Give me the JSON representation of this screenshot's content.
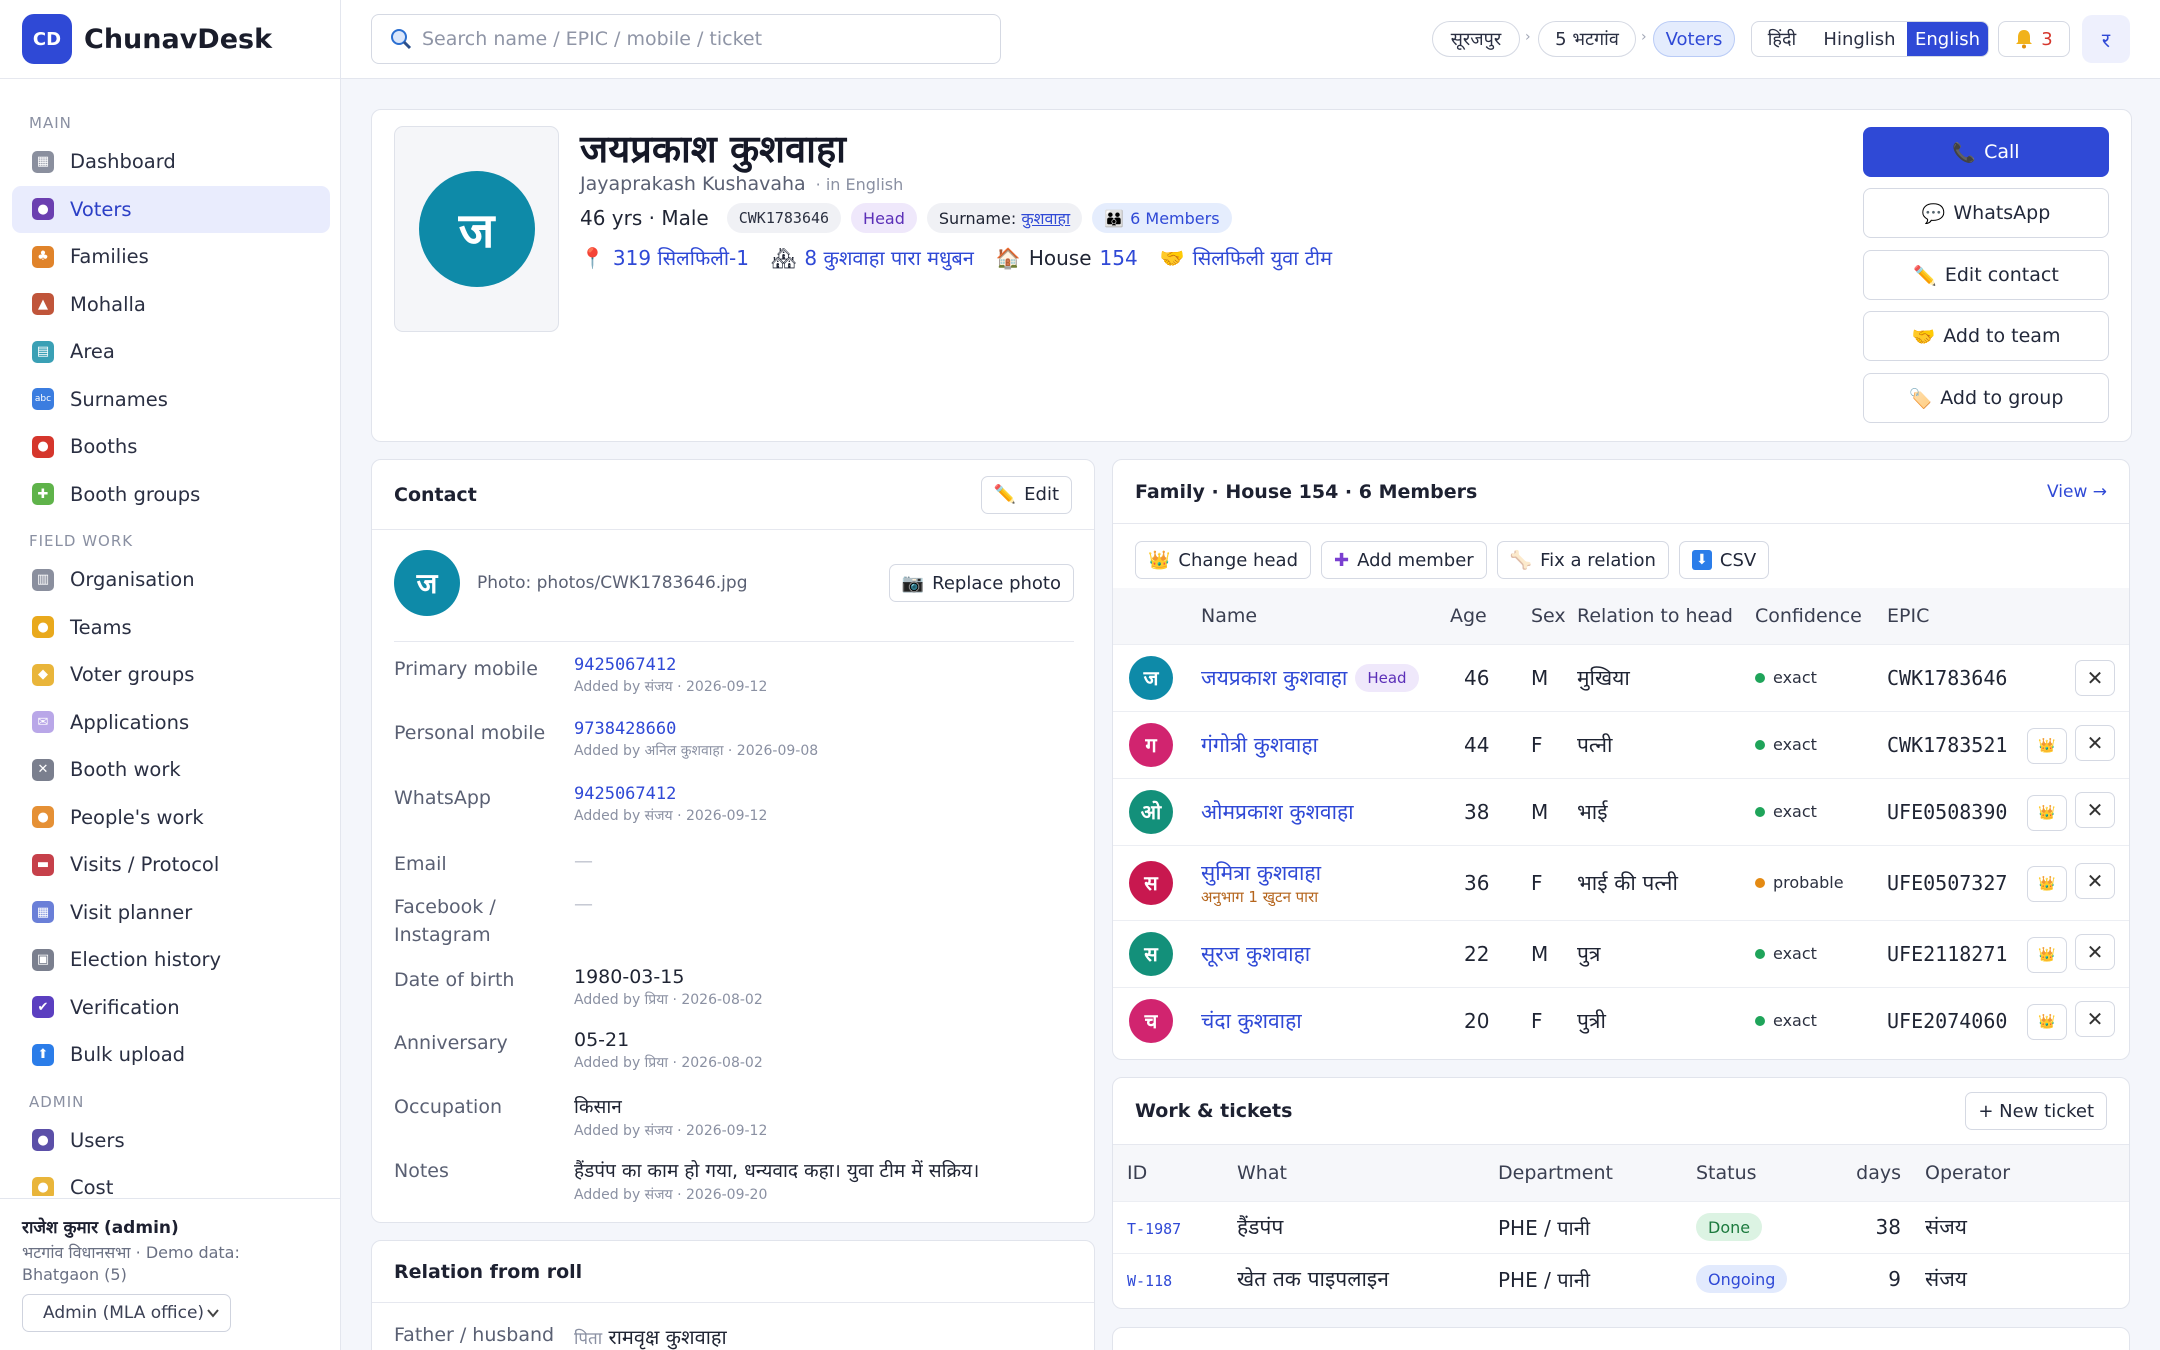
{
  "app": {
    "logo": "CD",
    "name": "ChunavDesk"
  },
  "sidebar": {
    "sections": [
      {
        "title": "MAIN",
        "items": [
          {
            "label": "Dashboard",
            "icon": "grid-icon"
          },
          {
            "label": "Voters",
            "icon": "person-icon",
            "active": true
          },
          {
            "label": "Families",
            "icon": "family-icon"
          },
          {
            "label": "Mohalla",
            "icon": "houses-icon"
          },
          {
            "label": "Area",
            "icon": "map-icon"
          },
          {
            "label": "Surnames",
            "icon": "abc-icon"
          },
          {
            "label": "Booths",
            "icon": "pin-icon"
          },
          {
            "label": "Booth groups",
            "icon": "puzzle-icon"
          }
        ]
      },
      {
        "title": "FIELD WORK",
        "items": [
          {
            "label": "Organisation",
            "icon": "building-icon"
          },
          {
            "label": "Teams",
            "icon": "handshake-icon"
          },
          {
            "label": "Voter groups",
            "icon": "tag-icon"
          },
          {
            "label": "Applications",
            "icon": "envelope-icon"
          },
          {
            "label": "Booth work",
            "icon": "tools-icon"
          },
          {
            "label": "People's work",
            "icon": "hand-icon"
          },
          {
            "label": "Visits / Protocol",
            "icon": "car-icon"
          },
          {
            "label": "Visit planner",
            "icon": "calendar-icon"
          },
          {
            "label": "Election history",
            "icon": "ballot-icon"
          },
          {
            "label": "Verification",
            "icon": "check-icon"
          },
          {
            "label": "Bulk upload",
            "icon": "upload-icon"
          }
        ]
      },
      {
        "title": "ADMIN",
        "items": [
          {
            "label": "Users",
            "icon": "users-icon"
          },
          {
            "label": "Cost",
            "icon": "coin-icon"
          }
        ]
      }
    ],
    "footer": {
      "user": "राजेश कुमार (admin)",
      "sub": "भटगांव विधानसभा · Demo data: Bhatgaon (5)",
      "role": "Admin (MLA office)"
    }
  },
  "topbar": {
    "search_placeholder": "Search name / EPIC / mobile / ticket",
    "crumbs": [
      "सूरजपुर",
      "5 भटगांव",
      "Voters"
    ],
    "languages": [
      "हिंदी",
      "Hinglish",
      "English"
    ],
    "active_language": "English",
    "notifications": "3",
    "user_initial": "र"
  },
  "profile": {
    "initial": "ज",
    "name": "जयप्रकाश कुशवाहा",
    "name_en": "Jayaprakash Kushavaha",
    "name_en_note": "· in English",
    "age_sex": "46 yrs · Male",
    "epic": "CWK1783646",
    "role_tag": "Head",
    "surname_label": "Surname:",
    "surname": "कुशवाहा",
    "members": "6 Members",
    "booth": "319 सिलफिली-1",
    "mohalla": "8 कुशवाहा पारा मधुबन",
    "house_label": "House",
    "house": "154",
    "team": "सिलफिली युवा टीम",
    "actions": [
      "Call",
      "WhatsApp",
      "Edit contact",
      "Add to team",
      "Add to group"
    ]
  },
  "contact": {
    "title": "Contact",
    "edit": "Edit",
    "photo_text": "Photo: photos/CWK1783646.jpg",
    "replace_photo": "Replace photo",
    "fields": [
      {
        "label": "Primary mobile",
        "value": "9425067412",
        "meta": "Added by संजय · 2026-09-12"
      },
      {
        "label": "Personal mobile",
        "value": "9738428660",
        "meta": "Added by अनिल कुशवाहा · 2026-09-08"
      },
      {
        "label": "WhatsApp",
        "value": "9425067412",
        "meta": "Added by संजय · 2026-09-12"
      },
      {
        "label": "Email",
        "value": "—",
        "meta": ""
      },
      {
        "label": "Facebook / Instagram",
        "value": "—",
        "meta": ""
      },
      {
        "label": "Date of birth",
        "value": "1980-03-15",
        "meta": "Added by प्रिया · 2026-08-02"
      },
      {
        "label": "Anniversary",
        "value": "05-21",
        "meta": "Added by प्रिया · 2026-08-02"
      },
      {
        "label": "Occupation",
        "value": "किसान",
        "meta": "Added by संजय · 2026-09-12"
      },
      {
        "label": "Notes",
        "value": "हैंडपंप का काम हो गया, धन्यवाद कहा। युवा टीम में सक्रिय।",
        "meta": "Added by संजय · 2026-09-20"
      }
    ]
  },
  "relation": {
    "title": "Relation from roll",
    "label": "Father / husband",
    "prefix": "पिता",
    "value": "रामवृक्ष कुशवाहा"
  },
  "family": {
    "title": "Family · House 154 · 6 Members",
    "view": "View →",
    "actions": [
      "Change head",
      "Add member",
      "Fix a relation",
      "CSV"
    ],
    "columns": [
      "Name",
      "Age",
      "Sex",
      "Relation to head",
      "Confidence",
      "EPIC"
    ],
    "rows": [
      {
        "initial": "ज",
        "color": "#0e8aa8",
        "name": "जयप्रकाश कुशवाहा",
        "tag": "Head",
        "sub": "",
        "age": "46",
        "sex": "M",
        "relation": "मुखिया",
        "confidence": "exact",
        "epic": "CWK1783646"
      },
      {
        "initial": "ग",
        "color": "#d1246f",
        "name": "गंगोत्री कुशवाहा",
        "tag": "",
        "sub": "",
        "age": "44",
        "sex": "F",
        "relation": "पत्नी",
        "confidence": "exact",
        "epic": "CWK1783521"
      },
      {
        "initial": "ओ",
        "color": "#13907a",
        "name": "ओमप्रकाश कुशवाहा",
        "tag": "",
        "sub": "",
        "age": "38",
        "sex": "M",
        "relation": "भाई",
        "confidence": "exact",
        "epic": "UFE0508390"
      },
      {
        "initial": "स",
        "color": "#c8184f",
        "name": "सुमित्रा कुशवाहा",
        "tag": "",
        "sub": "अनुभाग 1 खुटन पारा",
        "age": "36",
        "sex": "F",
        "relation": "भाई की पत्नी",
        "confidence": "probable",
        "epic": "UFE0507327"
      },
      {
        "initial": "स",
        "color": "#13907a",
        "name": "सूरज कुशवाहा",
        "tag": "",
        "sub": "",
        "age": "22",
        "sex": "M",
        "relation": "पुत्र",
        "confidence": "exact",
        "epic": "UFE2118271"
      },
      {
        "initial": "च",
        "color": "#d1246f",
        "name": "चंदा कुशवाहा",
        "tag": "",
        "sub": "",
        "age": "20",
        "sex": "F",
        "relation": "पुत्री",
        "confidence": "exact",
        "epic": "UFE2074060"
      }
    ]
  },
  "tickets": {
    "title": "Work & tickets",
    "new_ticket": "+ New ticket",
    "columns": [
      "ID",
      "What",
      "Department",
      "Status",
      "days",
      "Operator"
    ],
    "rows": [
      {
        "id": "T-1987",
        "what": "हैंडपंप",
        "department": "PHE / पानी",
        "status": "Done",
        "days": "38",
        "operator": "संजय"
      },
      {
        "id": "W-118",
        "what": "खेत तक पाइपलाइन",
        "department": "PHE / पानी",
        "status": "Ongoing",
        "days": "9",
        "operator": "संजय"
      }
    ]
  },
  "colors": {
    "accent": "#2f49d6",
    "exact": "#1fa45a",
    "probable": "#e48a12",
    "done_bg": "#dcf3e3",
    "ongoing_bg": "#e2eafd"
  }
}
